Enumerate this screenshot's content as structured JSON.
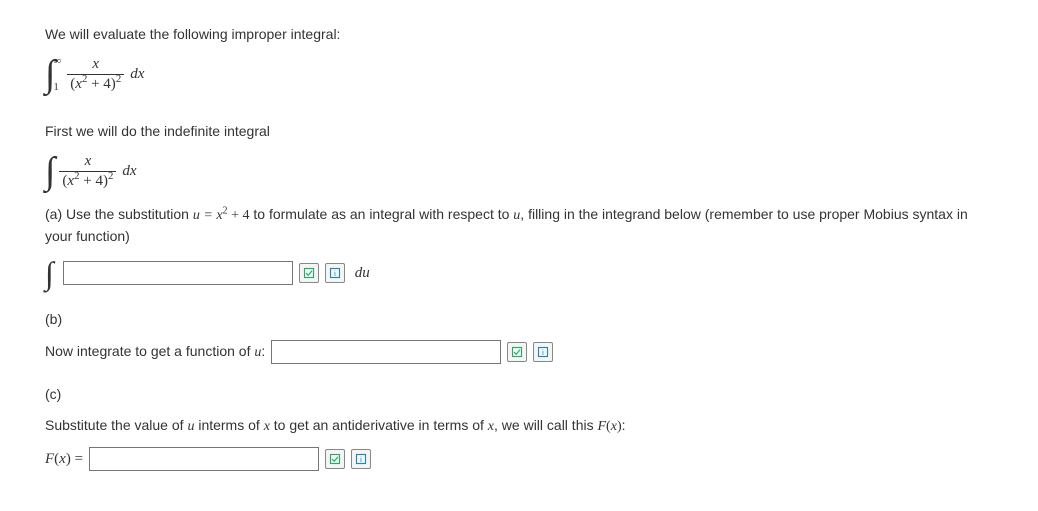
{
  "intro": "We will evaluate the following improper integral:",
  "integral1": {
    "lower": "1",
    "upper": "∞",
    "numerator": "x",
    "denominator_left": "(",
    "denominator_var": "x",
    "denominator_rest": " + 4)",
    "dx": "dx"
  },
  "first_line": "First we will do the indefinite integral",
  "integral2": {
    "numerator": "x",
    "denominator_left": "(",
    "denominator_var": "x",
    "denominator_rest": " + 4)",
    "dx": "dx"
  },
  "part_a": {
    "text_pre": "(a) Use the substitution ",
    "u_eq": "u = ",
    "x_var": "x",
    "plus4": " + 4",
    "text_post": " to formulate as an integral with respect to ",
    "u_var": "u",
    "text_end": ", filling in the integrand below (remember to use proper Mobius syntax in your function)",
    "du": "du"
  },
  "part_b": {
    "label": "(b)",
    "text_pre": "Now integrate to get a function of ",
    "u_var": "u",
    "colon": ":"
  },
  "part_c": {
    "label": "(c)",
    "text_pre": "Substitute the value of ",
    "u_var": "u",
    "text_mid": " interms of ",
    "x_var1": "x",
    "text_mid2": " to get an antiderivative in terms of ",
    "x_var2": "x",
    "text_end": ", we will call this ",
    "Fx_pre": "F",
    "Fx_paren": "(",
    "Fx_var": "x",
    "Fx_close": ")",
    "colon": ":",
    "Fx_label_pre": "F",
    "Fx_label_paren": "(",
    "Fx_label_var": "x",
    "Fx_label_close": ") ="
  },
  "sq": "2"
}
